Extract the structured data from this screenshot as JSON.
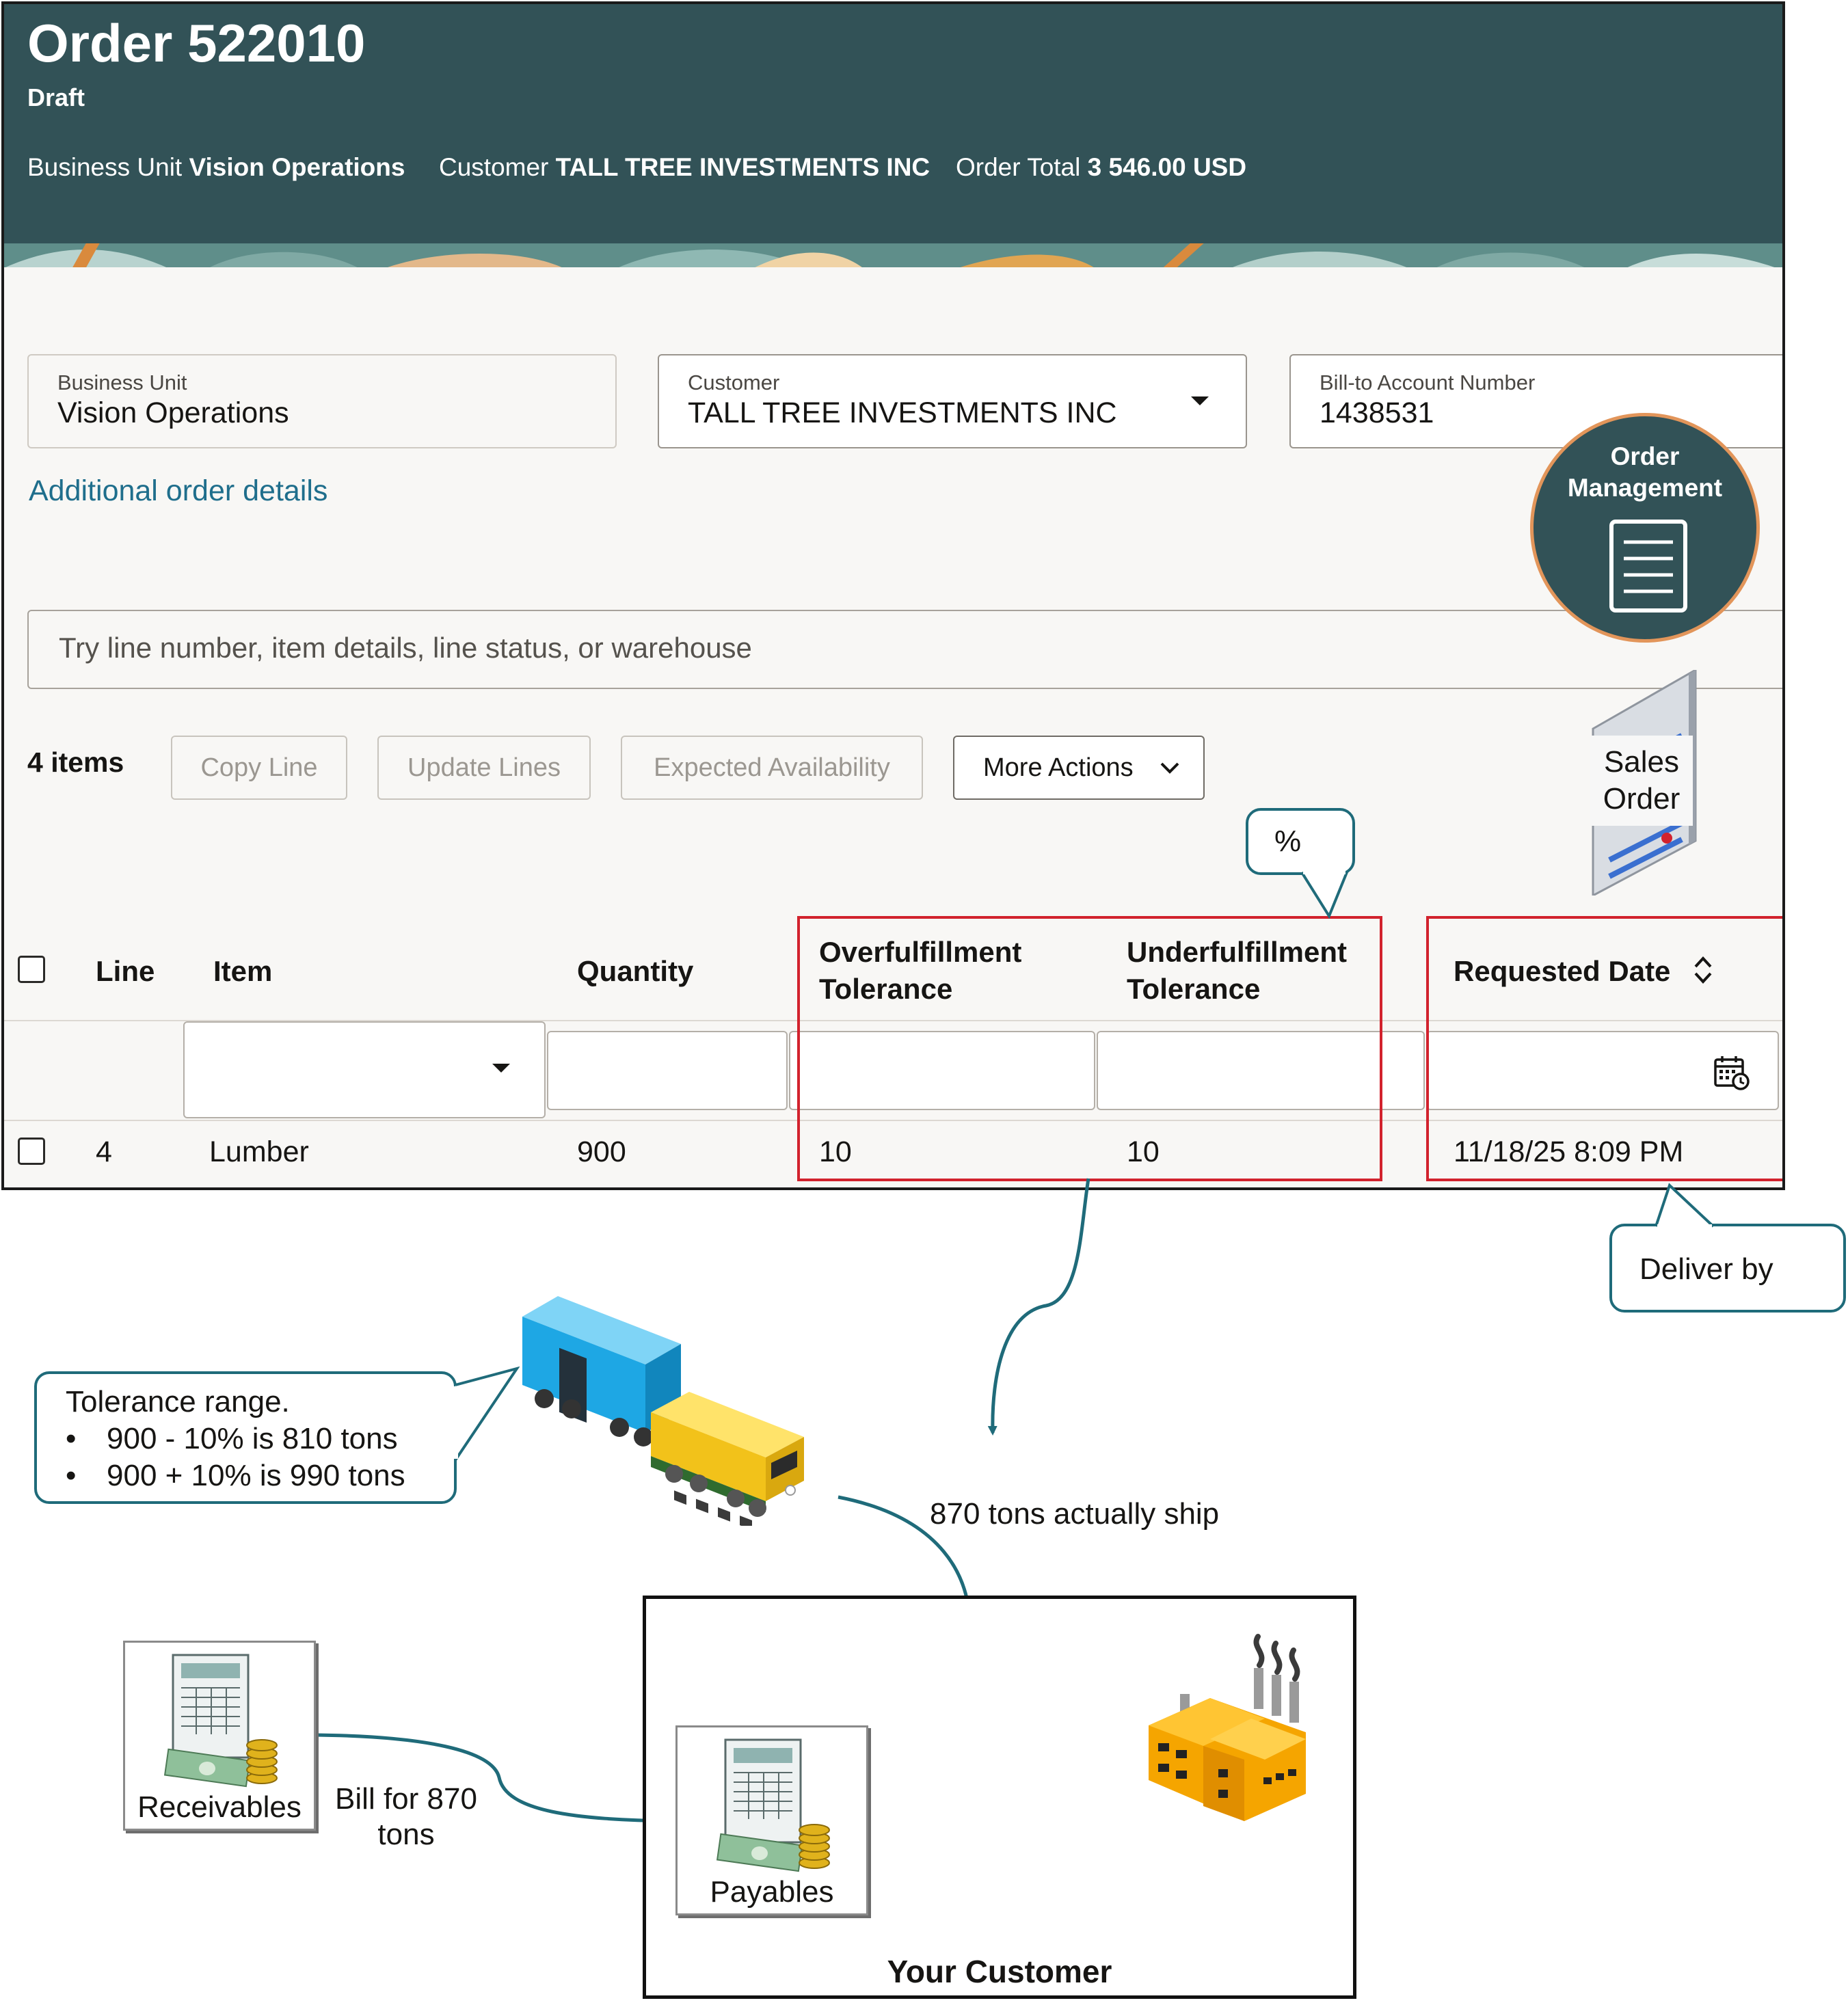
{
  "order": {
    "title": "Order 522010",
    "status": "Draft",
    "business_unit_label": "Business Unit",
    "business_unit": "Vision Operations",
    "customer_label": "Customer",
    "customer": "TALL TREE INVESTMENTS INC",
    "order_total_label": "Order Total",
    "order_total": "3 546.00 USD"
  },
  "fields": {
    "business_unit": {
      "label": "Business Unit",
      "value": "Vision Operations"
    },
    "customer": {
      "label": "Customer",
      "value": "TALL TREE INVESTMENTS INC"
    },
    "bill_to": {
      "label": "Bill-to Account Number",
      "value": "1438531"
    }
  },
  "additional_link": "Additional order details",
  "search": {
    "placeholder": "Try line number, item details, line status, or warehouse"
  },
  "toolbar": {
    "count": "4 items",
    "copy_line": "Copy Line",
    "update_lines": "Update Lines",
    "expected_availability": "Expected Availability",
    "more_actions": "More Actions"
  },
  "table": {
    "headers": {
      "line": "Line",
      "item": "Item",
      "quantity": "Quantity",
      "over_1": "Overfulfillment",
      "over_2": "Tolerance",
      "under_1": "Underfulfillment",
      "under_2": "Tolerance",
      "requested_date": "Requested Date"
    },
    "rows": [
      {
        "line": "4",
        "item": "Lumber",
        "quantity": "900",
        "over": "10",
        "under": "10",
        "requested_date": "11/18/25 8:09 PM"
      }
    ]
  },
  "badges": {
    "order_mgmt_1": "Order",
    "order_mgmt_2": "Management",
    "sales_order_1": "Sales",
    "sales_order_2": "Order"
  },
  "callouts": {
    "percent": "%",
    "deliver_by": "Deliver by",
    "tolerance_title": "Tolerance range.",
    "tolerance_items": [
      "900 - 10% is 810 tons",
      "900 + 10% is 990 tons"
    ],
    "ship": "870 tons actually ship",
    "bill_1": "Bill for 870",
    "bill_2": "tons",
    "receivables": "Receivables",
    "payables": "Payables",
    "your_customer": "Your Customer"
  },
  "colors": {
    "header": "#325257",
    "accent_link": "#1f6e8c",
    "highlight_red": "#d2222d",
    "callout_teal": "#1f6b7a"
  }
}
